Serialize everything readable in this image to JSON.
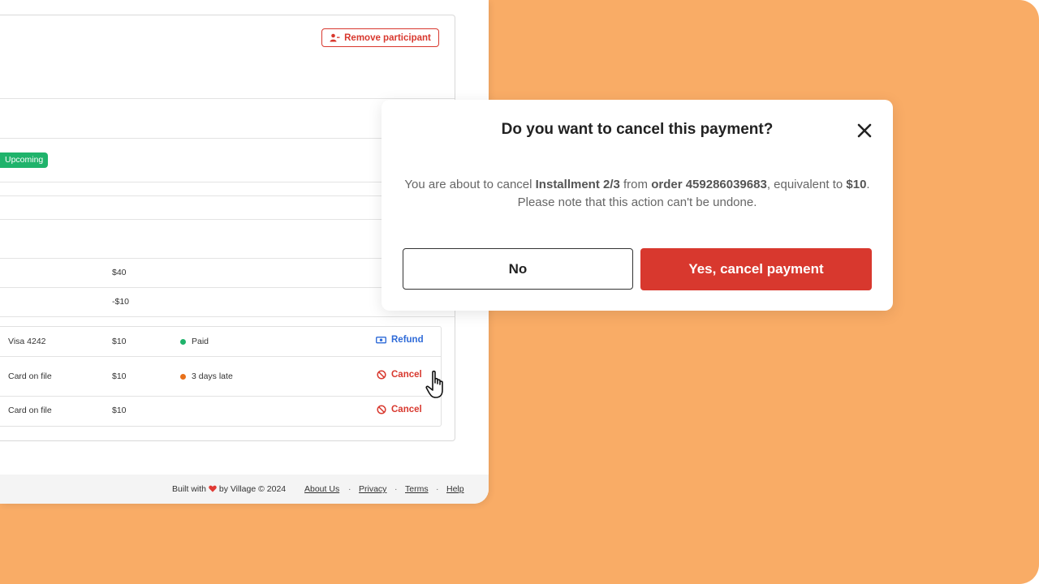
{
  "header": {
    "remove_participant_label": "Remove participant"
  },
  "status_badge": "Upcoming",
  "summary": {
    "total": "$40",
    "discount": "-$10"
  },
  "installments": [
    {
      "method": "Visa 4242",
      "amount": "$10",
      "status": "Paid",
      "status_color": "#1fb36b",
      "action": "Refund",
      "action_color": "#2f6bd8",
      "action_icon": "refund-icon"
    },
    {
      "method": "Card on file",
      "amount": "$10",
      "status": "3 days late",
      "status_color": "#e8701a",
      "action": "Cancel",
      "action_color": "#d8382e",
      "action_icon": "ban-icon"
    },
    {
      "method": "Card on file",
      "amount": "$10",
      "status": "",
      "status_color": "",
      "action": "Cancel",
      "action_color": "#d8382e",
      "action_icon": "ban-icon"
    }
  ],
  "footer": {
    "built_with_prefix": "Built with",
    "built_with_suffix": "by Village © 2024",
    "links": [
      "About Us",
      "Privacy",
      "Terms",
      "Help"
    ]
  },
  "modal": {
    "title": "Do you want to cancel this payment?",
    "body_1": "You are about to cancel ",
    "installment": "Installment 2/3",
    "body_2": " from ",
    "order": "order 459286039683",
    "body_3": ", equivalent to ",
    "amount": "$10",
    "body_4": ". Please note that this action can't be undone.",
    "no_label": "No",
    "yes_label": "Yes, cancel payment"
  },
  "colors": {
    "accent_red": "#d8382e",
    "background_orange": "#f9ac66",
    "success_green": "#1fb36b",
    "link_blue": "#2f6bd8"
  }
}
